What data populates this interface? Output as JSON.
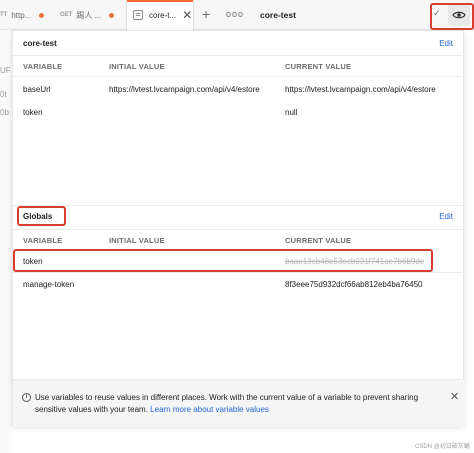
{
  "tabs": [
    {
      "method": "TT",
      "label": "http..."
    },
    {
      "method": "GET",
      "label": "踢人 ..."
    },
    {
      "label": "core-t..."
    }
  ],
  "tabbar": {
    "more": "ooo",
    "environment": "core-test"
  },
  "background_text": [
    "UF",
    "0t",
    "0b"
  ],
  "environment": {
    "title": "core-test",
    "edit_label": "Edit",
    "columns": [
      "VARIABLE",
      "INITIAL VALUE",
      "CURRENT VALUE"
    ],
    "rows": [
      {
        "variable": "baseUrl",
        "initial": "https://lvtest.lvcampaign.com/api/v4/estore",
        "current": "https://lvtest.lvcampaign.com/api/v4/estore"
      },
      {
        "variable": "token",
        "initial": "",
        "current": "null"
      }
    ]
  },
  "globals": {
    "title": "Globals",
    "edit_label": "Edit",
    "columns": [
      "VARIABLE",
      "INITIAL VALUE",
      "CURRENT VALUE"
    ],
    "rows": [
      {
        "variable": "token",
        "initial": "",
        "current": "baae13cb48e53ecb031f741ae7b6b9de"
      },
      {
        "variable": "manage-token",
        "initial": "",
        "current": "8f3eee75d932dcf66ab812eb4ba76450"
      }
    ]
  },
  "info": {
    "text": "Use variables to reuse values in different places. Work with the current value of a variable to prevent sharing sensitive values with your team.",
    "link": "Learn more about variable values"
  },
  "watermark": "CSDN @初日破灰蛹",
  "colors": {
    "accent": "#f26b3a",
    "link": "#2667d1",
    "highlight": "#d93f30",
    "unsaved_dot": "#e8743b"
  }
}
